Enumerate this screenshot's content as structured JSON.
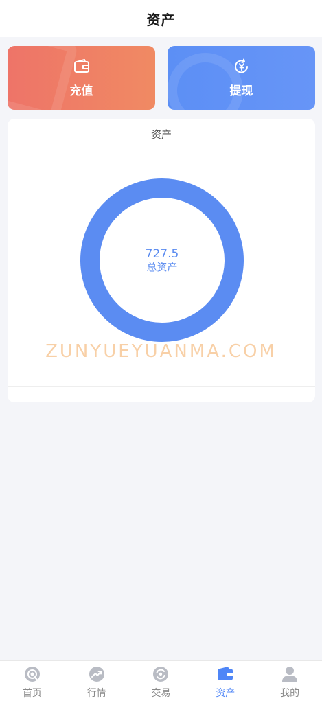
{
  "header": {
    "title": "资产"
  },
  "actions": {
    "recharge": {
      "label": "充值",
      "icon": "wallet-icon"
    },
    "withdraw": {
      "label": "提现",
      "icon": "yen-refresh-icon"
    }
  },
  "asset_card": {
    "title": "资产",
    "total_value": "727.5",
    "total_label": "总资产",
    "ring_color": "#5b8cf2"
  },
  "watermark": "ZUNYUEYUANMA.COM",
  "tabbar": {
    "items": [
      {
        "label": "首页",
        "icon": "home-icon",
        "active": false
      },
      {
        "label": "行情",
        "icon": "trend-icon",
        "active": false
      },
      {
        "label": "交易",
        "icon": "exchange-icon",
        "active": false
      },
      {
        "label": "资产",
        "icon": "wallet-icon",
        "active": true
      },
      {
        "label": "我的",
        "icon": "user-icon",
        "active": false
      }
    ],
    "active_color": "#4f86f7",
    "inactive_color": "#8a8a8a"
  }
}
